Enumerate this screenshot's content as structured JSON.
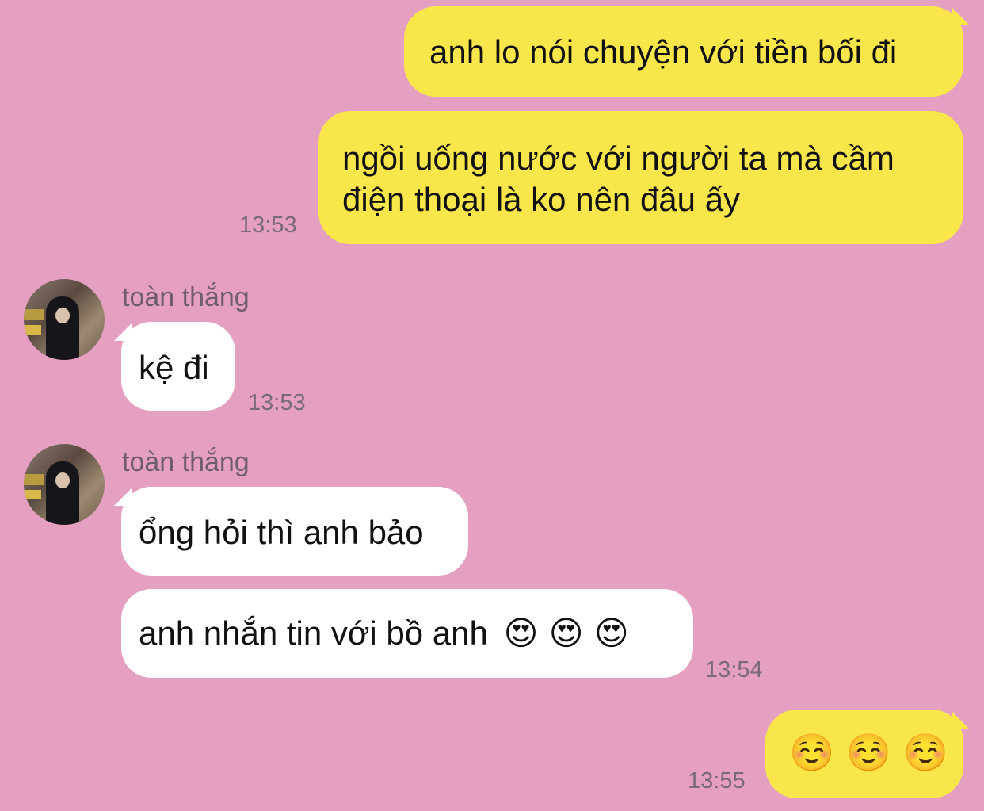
{
  "conversation": {
    "messages": [
      {
        "text": "anh lo nói chuyện với tiền bối đi"
      },
      {
        "line1": "ngồi uống nước với người ta mà cầm",
        "line2": "điện thoại là ko nên đâu ấy",
        "time": "13:53"
      },
      {
        "sender": "toàn thắng",
        "text": "kệ đi",
        "time": "13:53"
      },
      {
        "sender": "toàn thắng",
        "text": "ổng hỏi thì anh bảo"
      },
      {
        "text": "anh nhắn tin với bồ anh",
        "emojis": "😍 😍 😍",
        "time": "13:54"
      },
      {
        "emojis": "☺️ ☺️ ☺️",
        "time": "13:55"
      }
    ]
  },
  "colors": {
    "background": "#e5a0c1",
    "outgoing_bubble": "#f9e64a",
    "incoming_bubble": "#ffffff"
  },
  "icons": {
    "avatar": "user-avatar-photo"
  }
}
